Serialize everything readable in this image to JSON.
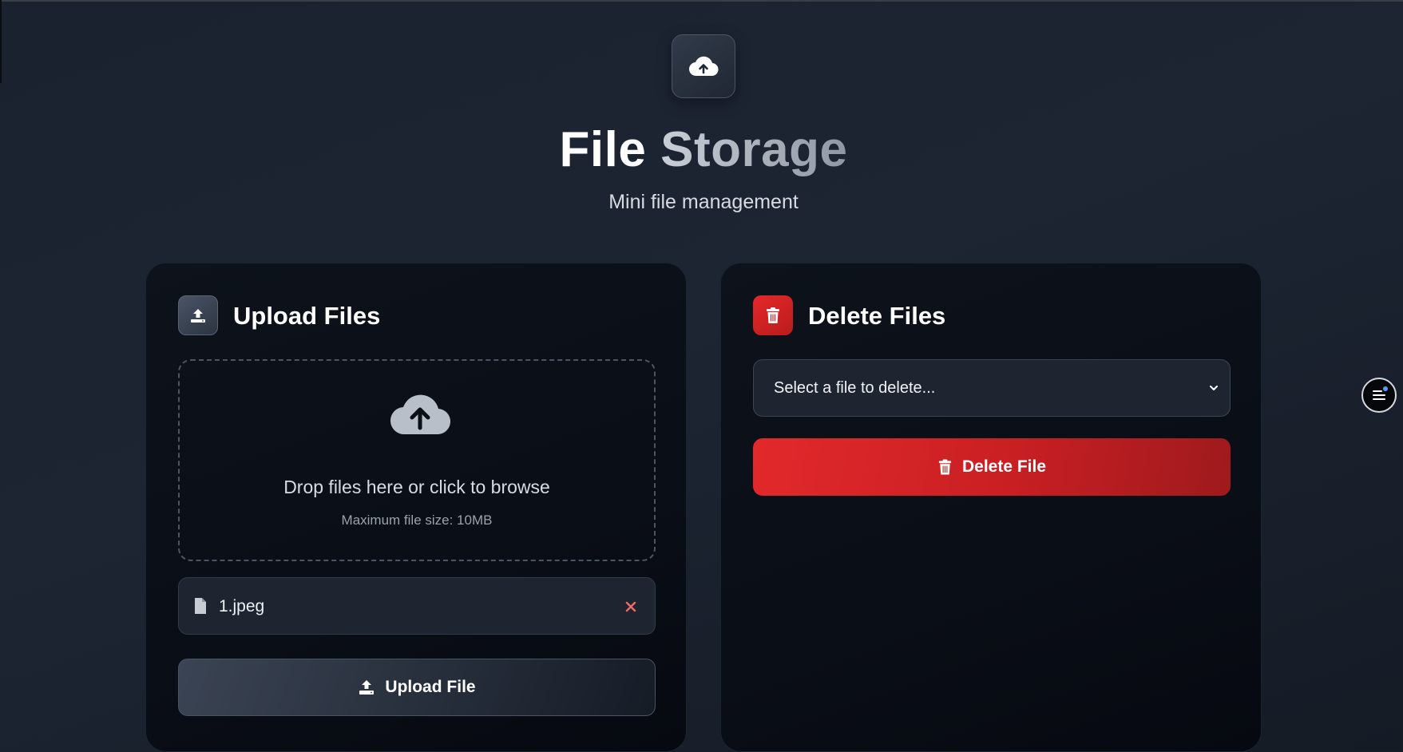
{
  "header": {
    "title_part1": "File",
    "title_part2": "Storage",
    "subtitle": "Mini file management",
    "icon": "cloud-upload-icon"
  },
  "upload": {
    "title": "Upload Files",
    "icon": "upload-tray-icon",
    "dropzone": {
      "text": "Drop files here or click to browse",
      "hint": "Maximum file size: 10MB",
      "icon": "cloud-upload-icon"
    },
    "selected_file": {
      "name": "1.jpeg",
      "icon": "file-icon",
      "remove_icon": "close-icon"
    },
    "button_label": "Upload File"
  },
  "delete": {
    "title": "Delete Files",
    "icon": "trash-icon",
    "select_placeholder": "Select a file to delete...",
    "button_label": "Delete File"
  },
  "colors": {
    "danger": "#dc2626",
    "remove_x": "#f06a6a",
    "floating_dot": "#4ea0ff"
  },
  "floating_button": {
    "icon": "menu-icon"
  }
}
